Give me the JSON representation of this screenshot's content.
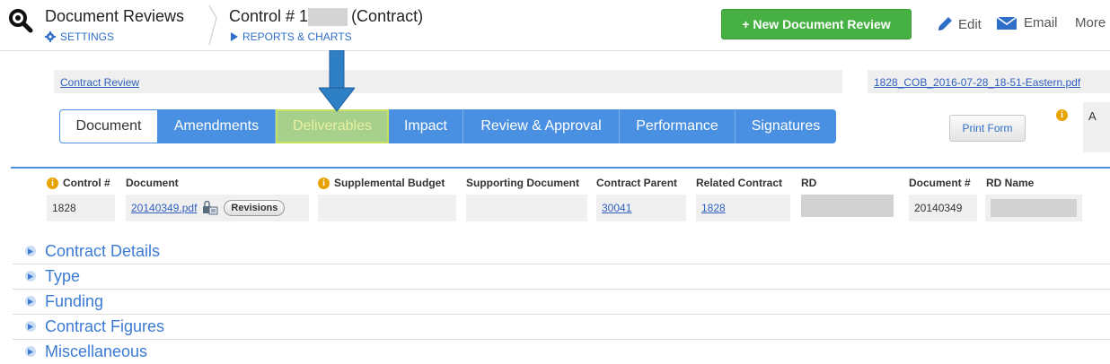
{
  "header": {
    "app_title": "Document Reviews",
    "settings_label": "SETTINGS",
    "record_title_prefix": "Control # 1",
    "record_title_suffix": "(Contract)",
    "reports_label": "REPORTS & CHARTS",
    "new_button_label": "+ New Document Review",
    "edit_label": "Edit",
    "email_label": "Email",
    "more_label": "More"
  },
  "document_bar": {
    "breadcrumb": "Contract Review",
    "file_name": "1828_COB_2016-07-28_18-51-Eastern.pdf"
  },
  "tabs": [
    {
      "label": "Document"
    },
    {
      "label": "Amendments"
    },
    {
      "label": "Deliverables"
    },
    {
      "label": "Impact"
    },
    {
      "label": "Review & Approval"
    },
    {
      "label": "Performance"
    },
    {
      "label": "Signatures"
    }
  ],
  "side": {
    "print_form_label": "Print Form",
    "panel_text": "A"
  },
  "fields": {
    "control": {
      "label": "Control #",
      "value": "1828"
    },
    "document": {
      "label": "Document",
      "file": "20140349.pdf",
      "revisions": "Revisions"
    },
    "supplemental_budget": {
      "label": "Supplemental Budget"
    },
    "supporting_document": {
      "label": "Supporting Document"
    },
    "contract_parent": {
      "label": "Contract Parent",
      "value": "30041"
    },
    "related_contract": {
      "label": "Related Contract",
      "value": "1828"
    },
    "rd": {
      "label": "RD"
    },
    "document_number": {
      "label": "Document #",
      "value": "20140349"
    },
    "rd_name": {
      "label": "RD Name"
    }
  },
  "sections": [
    {
      "label": "Contract Details"
    },
    {
      "label": "Type"
    },
    {
      "label": "Funding"
    },
    {
      "label": "Contract Figures"
    },
    {
      "label": "Miscellaneous"
    }
  ],
  "colors": {
    "primary": "#4a90e2",
    "success": "#46b142",
    "highlight_tab": "#a8d08d",
    "arrow": "#2f7fc4",
    "info": "#e8a300"
  }
}
